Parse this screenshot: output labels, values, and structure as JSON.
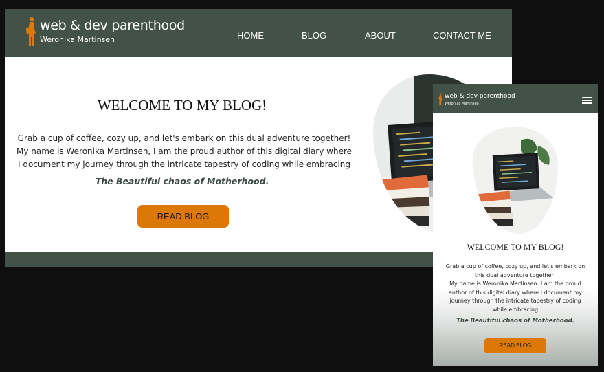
{
  "desktop": {
    "logo": {
      "title": "web & dev parenthood",
      "subtitle": "Weronika Martinsen"
    },
    "nav": [
      "HOME",
      "BLOG",
      "ABOUT",
      "CONTACT ME"
    ],
    "hero": {
      "title": "WELCOME TO MY BLOG!",
      "paragraph_lines": [
        "Grab a cup of coffee, cozy up, and let's embark on this dual adventure together!",
        "My name is Weronika Martinsen, I am the proud author of this digital diary where",
        "I document my journey through the intricate tapestry of coding while embracing"
      ],
      "quote": "The Beautiful chaos of Motherhood.",
      "button": "READ BLOG"
    }
  },
  "mobile": {
    "logo": {
      "title": "web & dev parenthood",
      "subtitle": "Weron ac Martinsen"
    },
    "hero": {
      "title": "WELCOME TO MY BLOG!",
      "paragraph_lines": [
        "Grab a cup of coffee, cozy up, and let's embark on",
        "this dual adventure together!",
        "My name is Weronika Martinsen. I am the proud",
        "author of this digital diary where I document my",
        "journey through the intricate tapestry of coding",
        "while embracing"
      ],
      "quote": "The Beautiful chaos of Motherhood.",
      "button": "READ BLOG"
    }
  },
  "colors": {
    "header": "#435249",
    "accent": "#dc7807",
    "background": "#0f0f0f"
  },
  "icons": {
    "logo": "mother-child-figure-icon",
    "menu": "hamburger-menu-icon",
    "photo": "laptop-books-photo"
  }
}
